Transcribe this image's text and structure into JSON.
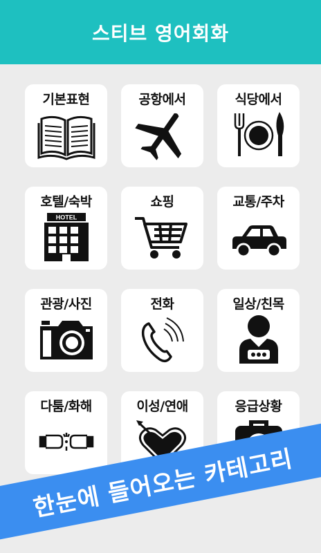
{
  "header": {
    "title": "스티브 영어회화"
  },
  "categories": [
    {
      "label": "기본표현",
      "icon": "book-icon"
    },
    {
      "label": "공항에서",
      "icon": "airplane-icon"
    },
    {
      "label": "식당에서",
      "icon": "dining-icon"
    },
    {
      "label": "호텔/숙박",
      "icon": "hotel-icon"
    },
    {
      "label": "쇼핑",
      "icon": "shopping-cart-icon"
    },
    {
      "label": "교통/주차",
      "icon": "car-icon"
    },
    {
      "label": "관광/사진",
      "icon": "camera-icon"
    },
    {
      "label": "전화",
      "icon": "phone-icon"
    },
    {
      "label": "일상/친목",
      "icon": "person-icon"
    },
    {
      "label": "다툼/화해",
      "icon": "fist-bump-icon"
    },
    {
      "label": "이성/연애",
      "icon": "heart-arrow-icon"
    },
    {
      "label": "응급상황",
      "icon": "first-aid-kit-icon"
    }
  ],
  "hotel_sign": "HOTEL",
  "banner": {
    "text": "한눈에 들어오는 카테고리"
  },
  "colors": {
    "header": "#1ec0c0",
    "banner": "#3b8ef0",
    "background": "#ececec"
  }
}
